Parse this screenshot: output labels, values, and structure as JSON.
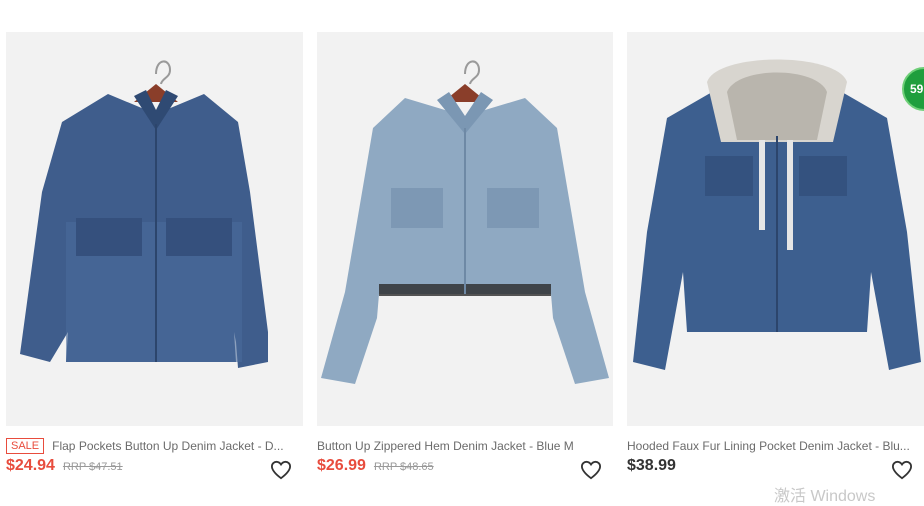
{
  "products": [
    {
      "sale_tag": "SALE",
      "title": "Flap Pockets Button Up Denim Jacket - D...",
      "price": "$24.94",
      "rrp": "RRP $47.51",
      "wishlist_icon": "heart-outline-icon"
    },
    {
      "title": "Button Up Zippered Hem Denim Jacket - Blue M",
      "price": "$26.99",
      "rrp": "RRP $48.65",
      "wishlist_icon": "heart-outline-icon"
    },
    {
      "title": "Hooded Faux Fur Lining Pocket Denim Jacket - Blu...",
      "price": "$38.99",
      "wishlist_icon": "heart-outline-icon"
    }
  ],
  "overlay_badge": "59",
  "os_watermark": "激活 Windows",
  "colors": {
    "sale_red": "#e84c3d",
    "text_gray": "#6b6b6b",
    "rrp_gray": "#999999",
    "denim_dark": "#3f5d8c",
    "denim_light": "#8fa9c2",
    "hanger_wood": "#8a3e2a"
  }
}
